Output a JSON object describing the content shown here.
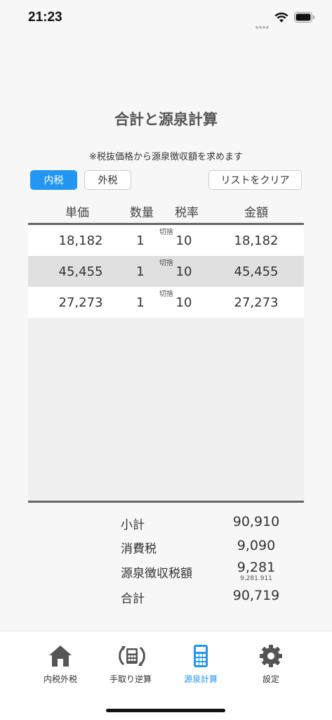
{
  "status": {
    "time": "21:23"
  },
  "page": {
    "title": "合計と源泉計算",
    "subtitle": "※税抜価格から源泉徴収額を求めます"
  },
  "toggle": {
    "inner_tax": "内税",
    "outer_tax": "外税",
    "selected": "内税"
  },
  "clear_button": "リストをクリア",
  "table": {
    "headers": {
      "unit_price": "単価",
      "quantity": "数量",
      "tax_rate": "税率",
      "amount": "金額"
    },
    "rows": [
      {
        "unit_price": "18,182",
        "quantity": "1",
        "rounding": "切捨",
        "tax_rate": "10",
        "amount": "18,182"
      },
      {
        "unit_price": "45,455",
        "quantity": "1",
        "rounding": "切捨",
        "tax_rate": "10",
        "amount": "45,455"
      },
      {
        "unit_price": "27,273",
        "quantity": "1",
        "rounding": "切捨",
        "tax_rate": "10",
        "amount": "27,273"
      }
    ]
  },
  "summary": {
    "subtotal_label": "小計",
    "subtotal_value": "90,910",
    "tax_label": "消費税",
    "tax_value": "9,090",
    "withholding_label": "源泉徴収税額",
    "withholding_value": "9,281",
    "withholding_detail": "9,281.911",
    "total_label": "合計",
    "total_value": "90,719"
  },
  "tabs": [
    {
      "label": "内税外税",
      "icon": "home-icon"
    },
    {
      "label": "手取り逆算",
      "icon": "calculator-cycle-icon"
    },
    {
      "label": "源泉計算",
      "icon": "calculator-icon"
    },
    {
      "label": "設定",
      "icon": "gear-icon"
    }
  ],
  "colors": {
    "accent": "#2196f3"
  }
}
